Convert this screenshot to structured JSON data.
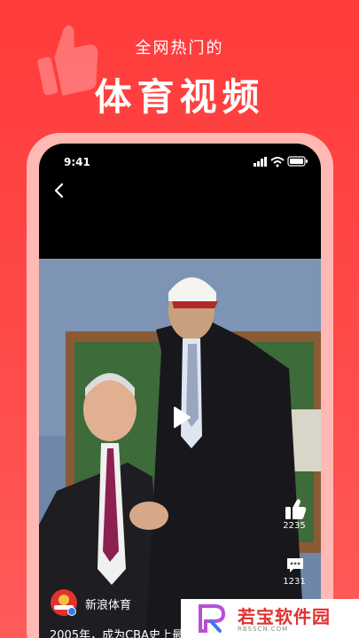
{
  "header": {
    "subtitle": "全网热门的",
    "title": "体育视频"
  },
  "status_bar": {
    "time": "9:41"
  },
  "video": {
    "likes": "2235",
    "comments": "1231"
  },
  "channel": {
    "name": "新浪体育",
    "caption": "2005年，成为CBA史上最"
  },
  "watermark": {
    "text": "若宝软件园",
    "sub": "RBSSCN.COM"
  },
  "icons": [
    "thumbs-up-icon",
    "back-icon",
    "play-icon",
    "like-icon",
    "comment-icon",
    "signal-icon",
    "wifi-icon",
    "battery-icon"
  ],
  "colors": {
    "background": "#ff4141",
    "frame": "#ffb9b4",
    "accent": "#e0322f"
  }
}
